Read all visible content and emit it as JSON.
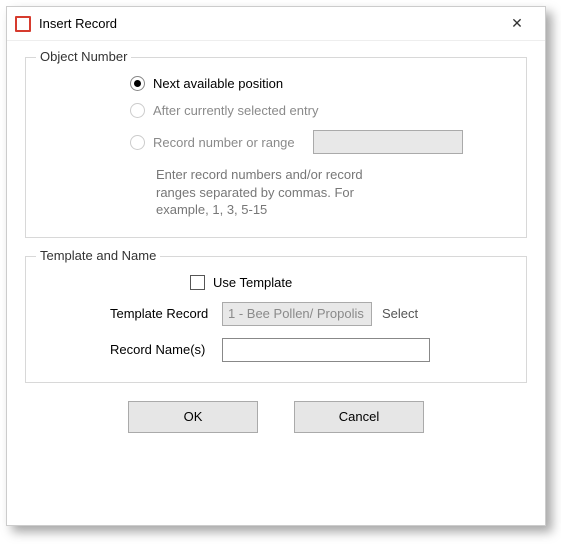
{
  "window": {
    "title": "Insert Record"
  },
  "objectNumber": {
    "legend": "Object Number",
    "options": {
      "next": "Next available position",
      "after": "After currently selected entry",
      "range": "Record number or range"
    },
    "hint": "Enter record numbers and/or record ranges separated by commas. For example, 1, 3, 5-15",
    "rangeValue": ""
  },
  "templateName": {
    "legend": "Template and Name",
    "useTemplateLabel": "Use Template",
    "templateRecordLabel": "Template Record",
    "templateRecordValue": "1 - Bee Pollen/ Propolis",
    "selectLabel": "Select",
    "recordNameLabel": "Record Name(s)",
    "recordNameValue": ""
  },
  "buttons": {
    "ok": "OK",
    "cancel": "Cancel"
  }
}
